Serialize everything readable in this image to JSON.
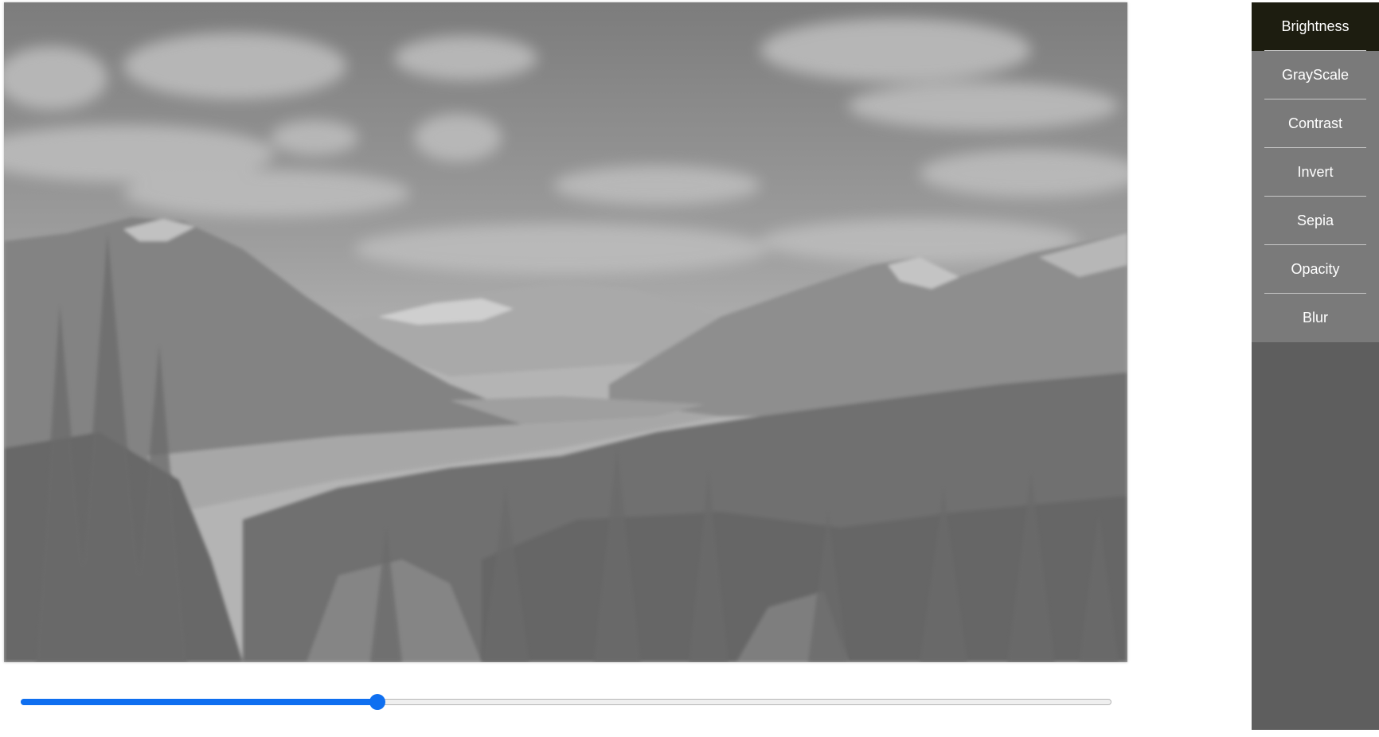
{
  "filters": {
    "items": [
      {
        "label": "Brightness",
        "active": true
      },
      {
        "label": "GrayScale",
        "active": false
      },
      {
        "label": "Contrast",
        "active": false
      },
      {
        "label": "Invert",
        "active": false
      },
      {
        "label": "Sepia",
        "active": false
      },
      {
        "label": "Opacity",
        "active": false
      },
      {
        "label": "Blur",
        "active": false
      }
    ]
  },
  "slider": {
    "value_fraction": 0.327,
    "accent_color": "#0f6ff0"
  },
  "photo": {
    "subject": "mountain-valley-landscape",
    "rendering": "grayscale-blurred"
  },
  "colors": {
    "sidebar_background": "#5e5e5e",
    "menu_item_background": "#7a7a7a",
    "menu_item_active_background": "#1d1d10",
    "menu_text": "#ffffff"
  }
}
